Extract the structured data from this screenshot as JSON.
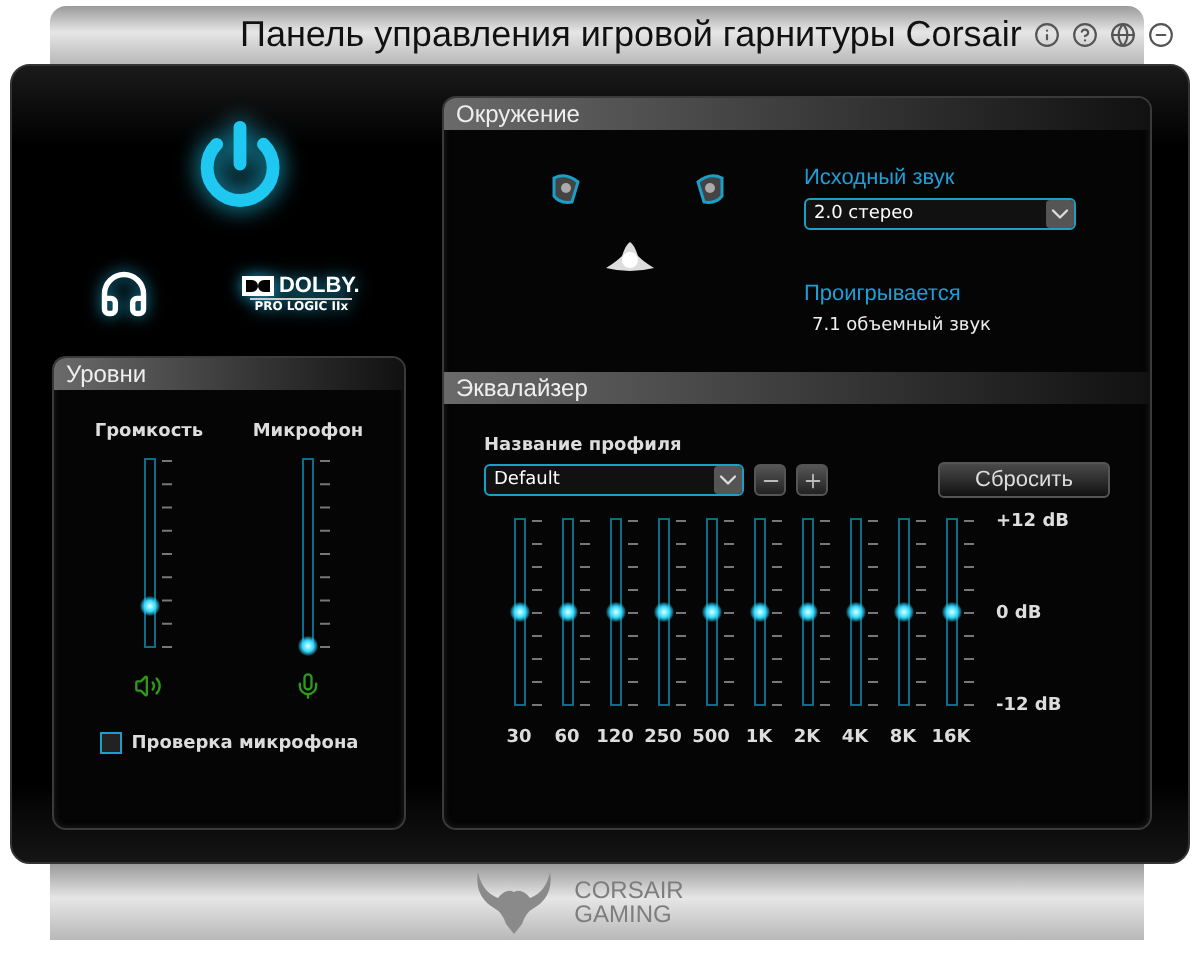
{
  "window": {
    "title": "Панель управления игровой гарнитуры Corsair"
  },
  "power": {
    "on": true
  },
  "dolby": {
    "name": "DOLBY.",
    "subtitle": "PRO LOGIC IIx"
  },
  "levels": {
    "title": "Уровни",
    "sliders": [
      {
        "label": "Громкость",
        "level": 0.21,
        "kind": "speaker"
      },
      {
        "label": "Микрофон",
        "level": 0,
        "kind": "mic"
      }
    ],
    "mic_test": {
      "label": "Проверка микрофона",
      "checked": false
    }
  },
  "surround": {
    "title": "Окружение",
    "source_label": "Исходный звук",
    "source_value": "2.0 стерео",
    "playing_label": "Проигрывается",
    "playing_value": "7.1 объемный звук"
  },
  "equalizer": {
    "title": "Эквалайзер",
    "profile_label": "Название профиля",
    "profile_value": "Default",
    "reset": "Сбросить",
    "scale": [
      "+12 dB",
      "0 dB",
      "-12 dB"
    ],
    "bands": [
      {
        "label": "30",
        "level": 0.5
      },
      {
        "label": "60",
        "level": 0.5
      },
      {
        "label": "120",
        "level": 0.5
      },
      {
        "label": "250",
        "level": 0.5
      },
      {
        "label": "500",
        "level": 0.5
      },
      {
        "label": "1K",
        "level": 0.5
      },
      {
        "label": "2K",
        "level": 0.5
      },
      {
        "label": "4K",
        "level": 0.5
      },
      {
        "label": "8K",
        "level": 0.5
      },
      {
        "label": "16K",
        "level": 0.5
      }
    ]
  },
  "footer": {
    "brand": "CORSAIR",
    "subtitle": "GAMING"
  }
}
